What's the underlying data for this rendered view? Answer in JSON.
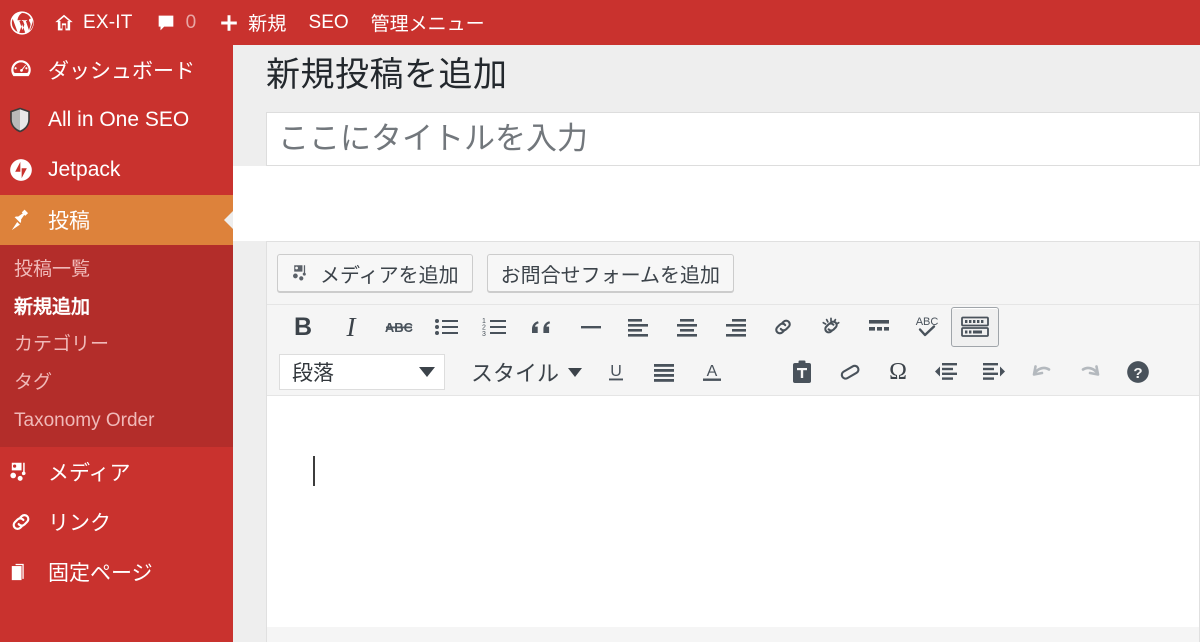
{
  "adminbar": {
    "items": [
      {
        "id": "wp-logo",
        "icon": "wordpress-icon",
        "label": "",
        "count": null
      },
      {
        "id": "site-name",
        "icon": "home-icon",
        "label": "EX-IT",
        "count": null
      },
      {
        "id": "comments",
        "icon": "comment-icon",
        "label": "",
        "count": "0"
      },
      {
        "id": "new-content",
        "icon": "plus-icon",
        "label": "新規",
        "count": null
      },
      {
        "id": "seo",
        "icon": null,
        "label": "SEO",
        "count": null
      },
      {
        "id": "admin-menu",
        "icon": null,
        "label": "管理メニュー",
        "count": null
      }
    ]
  },
  "sidebar": {
    "items": [
      {
        "label": "ダッシュボード",
        "icon": "dashboard-icon",
        "current": false
      },
      {
        "label": "All in One SEO",
        "icon": "shield-icon",
        "current": false
      },
      {
        "label": "Jetpack",
        "icon": "jetpack-icon",
        "current": false
      },
      {
        "label": "投稿",
        "icon": "pin-icon",
        "current": true
      },
      {
        "label": "メディア",
        "icon": "media-icon",
        "current": false
      },
      {
        "label": "リンク",
        "icon": "link-icon",
        "current": false
      },
      {
        "label": "固定ページ",
        "icon": "page-icon",
        "current": false
      }
    ],
    "submenu": [
      {
        "label": "投稿一覧",
        "current": false
      },
      {
        "label": "新規追加",
        "current": true
      },
      {
        "label": "カテゴリー",
        "current": false
      },
      {
        "label": "タグ",
        "current": false
      },
      {
        "label": "Taxonomy Order",
        "current": false
      }
    ]
  },
  "page": {
    "title": "新規投稿を追加"
  },
  "post_title": {
    "value": "",
    "placeholder": "ここにタイトルを入力"
  },
  "media_buttons": [
    {
      "label": "メディアを追加",
      "icon": "media-icon"
    },
    {
      "label": "お問合せフォームを追加",
      "icon": null
    }
  ],
  "toolbar_row1": [
    {
      "name": "bold-button",
      "glyph": "B",
      "kind": "text-bold",
      "active": false
    },
    {
      "name": "italic-button",
      "glyph": "I",
      "kind": "text-ital",
      "active": false
    },
    {
      "name": "strikethrough-button",
      "glyph": "ABC",
      "kind": "strike",
      "active": false
    },
    {
      "name": "bullet-list-button",
      "glyph": "",
      "kind": "ul",
      "active": false
    },
    {
      "name": "numbered-list-button",
      "glyph": "",
      "kind": "ol",
      "active": false
    },
    {
      "name": "blockquote-button",
      "glyph": "“",
      "kind": "quote",
      "active": false
    },
    {
      "name": "horizontal-rule-button",
      "glyph": "",
      "kind": "hr",
      "active": false
    },
    {
      "name": "align-left-button",
      "glyph": "",
      "kind": "alignleft",
      "active": false
    },
    {
      "name": "align-center-button",
      "glyph": "",
      "kind": "aligncenter",
      "active": false
    },
    {
      "name": "align-right-button",
      "glyph": "",
      "kind": "alignright",
      "active": false
    },
    {
      "name": "insert-link-button",
      "glyph": "",
      "kind": "link",
      "active": false
    },
    {
      "name": "remove-link-button",
      "glyph": "",
      "kind": "unlink",
      "active": false
    },
    {
      "name": "read-more-button",
      "glyph": "",
      "kind": "more",
      "active": false
    },
    {
      "name": "spellcheck-button",
      "glyph": "ABC",
      "kind": "spell",
      "active": false
    },
    {
      "name": "kitchen-sink-button",
      "glyph": "",
      "kind": "keyboard",
      "active": true
    }
  ],
  "toolbar_row2": {
    "format_select": {
      "label": "段落",
      "name": "paragraph-format-select"
    },
    "styles_label": "スタイル",
    "buttons": [
      {
        "name": "underline-button",
        "kind": "underline",
        "disabled": false
      },
      {
        "name": "justify-button",
        "kind": "justify",
        "disabled": false
      },
      {
        "name": "text-color-button",
        "kind": "textcolor",
        "disabled": false
      },
      {
        "name": "paste-as-text-button",
        "kind": "pastetext",
        "disabled": false
      },
      {
        "name": "clear-formatting-button",
        "kind": "removeformat",
        "disabled": false
      },
      {
        "name": "special-character-button",
        "kind": "charmap",
        "disabled": false
      },
      {
        "name": "outdent-button",
        "kind": "outdent",
        "disabled": false
      },
      {
        "name": "indent-button",
        "kind": "indent",
        "disabled": false
      },
      {
        "name": "undo-button",
        "kind": "undo",
        "disabled": true
      },
      {
        "name": "redo-button",
        "kind": "redo",
        "disabled": true
      },
      {
        "name": "help-button",
        "kind": "help",
        "disabled": false
      }
    ]
  },
  "colors": {
    "admin_bar": "#c9322e",
    "sidebar": "#c9322e",
    "submenu": "#b32d2a",
    "current_menu": "#dd823b",
    "content_bg": "#eeeeee",
    "editor_bg": "#f5f5f5"
  }
}
